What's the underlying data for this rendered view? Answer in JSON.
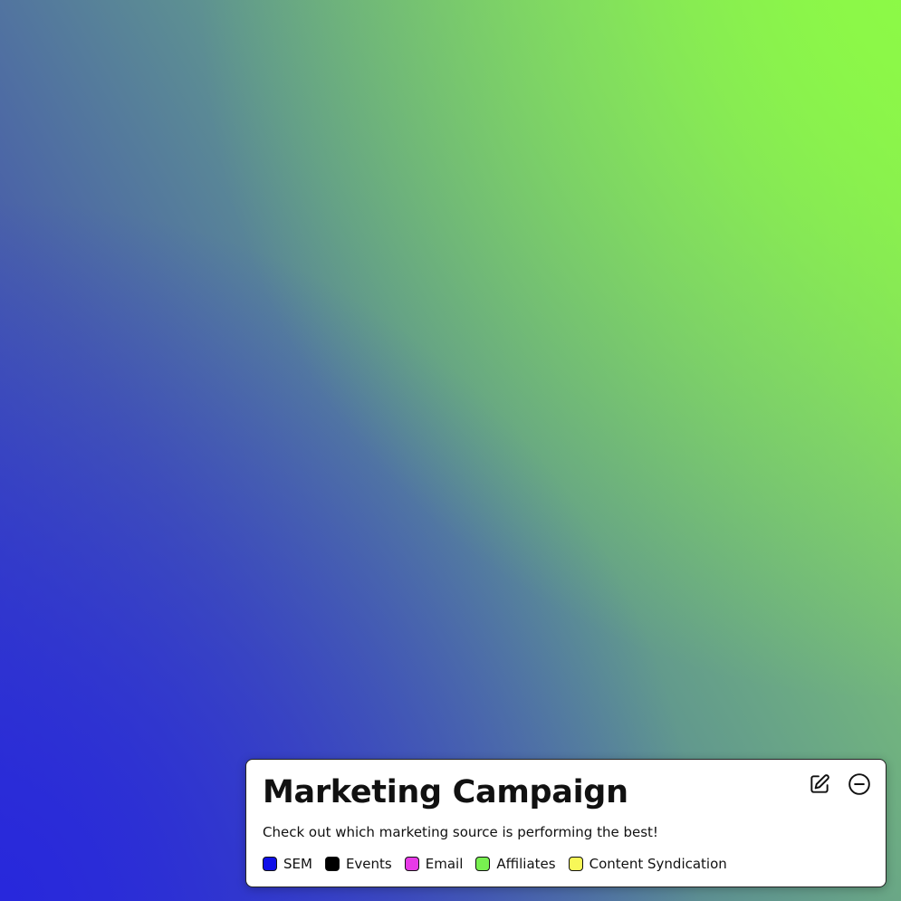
{
  "legend": {
    "title": "Marketing Campaign",
    "description": "Check out which marketing source is performing the best!",
    "items": [
      {
        "label": "SEM",
        "color": "#1010e8"
      },
      {
        "label": "Events",
        "color": "#000000"
      },
      {
        "label": "Email",
        "color": "#e83ae8"
      },
      {
        "label": "Affiliates",
        "color": "#78f050"
      },
      {
        "label": "Content Syndication",
        "color": "#f8f858"
      }
    ],
    "actions": [
      {
        "icon": "edit-icon"
      },
      {
        "icon": "minus-circle-icon"
      }
    ]
  },
  "background": {
    "colors": [
      "#2a2ad6",
      "#5f9490",
      "#8ef04e"
    ]
  }
}
